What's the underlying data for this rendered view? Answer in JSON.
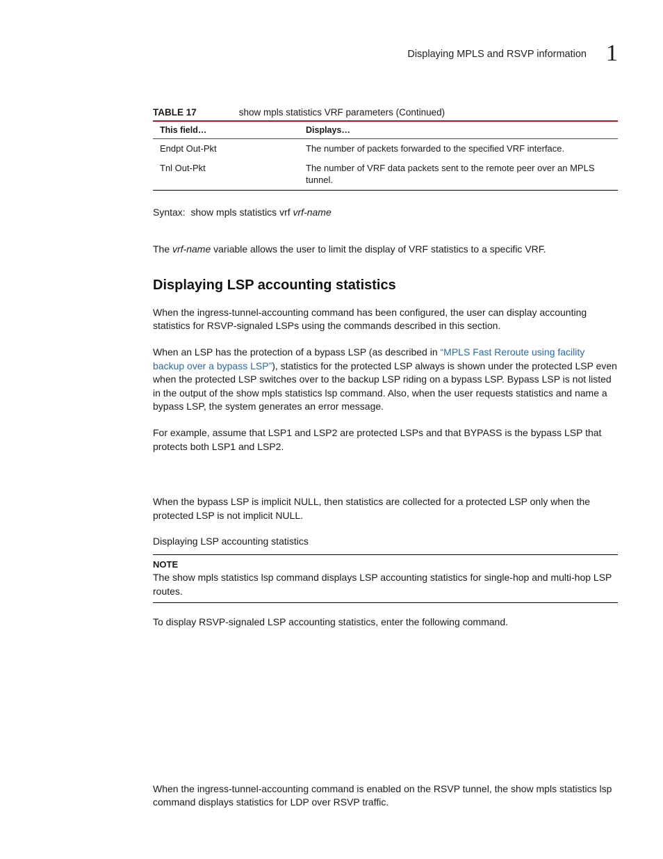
{
  "header": {
    "running_title": "Displaying MPLS and RSVP information",
    "chapter_number": "1"
  },
  "table": {
    "label": "TABLE 17",
    "title": "show mpls statistics VRF parameters  (Continued)",
    "th1": "This field…",
    "th2": "Displays…",
    "rows": [
      {
        "field": "Endpt Out-Pkt",
        "desc": "The number of packets forwarded to the specified VRF interface."
      },
      {
        "field": "Tnl Out-Pkt",
        "desc": "The number of VRF data packets sent to the remote peer over an MPLS tunnel."
      }
    ]
  },
  "syntax": {
    "prefix": "Syntax:",
    "cmd": "show mpls statistics vrf",
    "var": "vrf-name"
  },
  "para1": {
    "a": "The ",
    "var": "vrf-name",
    "b": " variable allows the user to limit the display of VRF statistics to a specific VRF."
  },
  "section_heading": "Displaying LSP accounting statistics",
  "para2": "When the ingress-tunnel-accounting command has been configured, the user can display accounting statistics for RSVP-signaled LSPs using the commands described in this section.",
  "para3": {
    "a": "When an LSP has the protection of a bypass LSP (as described in ",
    "link": "“MPLS Fast Reroute using facility backup over a bypass LSP”",
    "b": "), statistics for the protected LSP always is shown under the protected LSP even when the protected LSP switches over to the backup LSP riding on a bypass LSP. Bypass LSP is not listed in the output of the show mpls statistics lsp command. Also, when the user requests statistics and name a bypass LSP, the system generates an error message."
  },
  "para4": "For example, assume that LSP1 and LSP2 are protected LSPs and that BYPASS is the bypass LSP that protects both LSP1 and LSP2.",
  "para5": "When the bypass LSP is implicit NULL, then statistics are collected for a protected LSP only when the protected LSP is not implicit NULL.",
  "para6": "Displaying LSP accounting statistics",
  "note": {
    "label": "NOTE",
    "text": "The show mpls statistics lsp command displays LSP accounting statistics for single-hop and multi-hop LSP routes."
  },
  "para7": "To display RSVP-signaled LSP accounting statistics, enter the following command.",
  "para8": "When the ingress-tunnel-accounting command is enabled on the RSVP tunnel, the show mpls statistics lsp command displays statistics for LDP over RSVP traffic."
}
